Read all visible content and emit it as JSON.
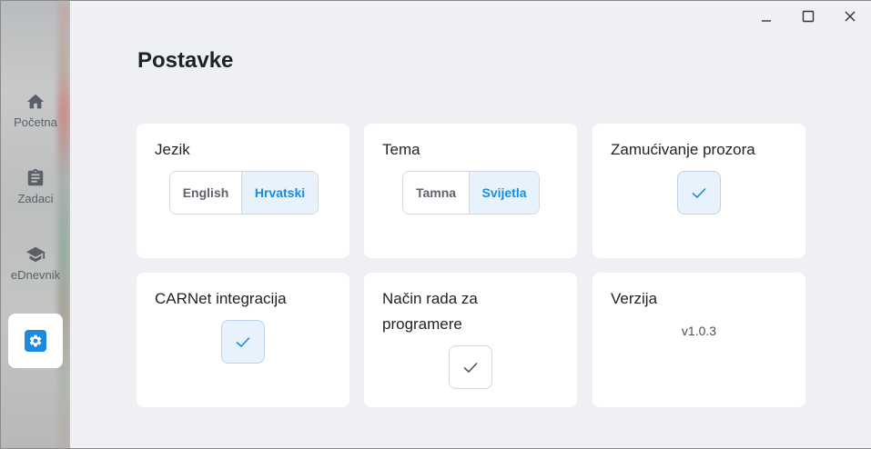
{
  "sidebar": {
    "items": [
      {
        "label": "Početna",
        "icon": "home-icon"
      },
      {
        "label": "Zadaci",
        "icon": "clipboard-icon"
      },
      {
        "label": "eDnevnik",
        "icon": "graduation-cap-icon"
      }
    ],
    "active": {
      "icon": "gear-icon"
    }
  },
  "window": {
    "minimize_icon": "minimize-icon",
    "maximize_icon": "maximize-icon",
    "close_icon": "close-icon"
  },
  "page": {
    "title": "Postavke"
  },
  "cards": {
    "language": {
      "title": "Jezik",
      "options": [
        "English",
        "Hrvatski"
      ],
      "selected": "Hrvatski"
    },
    "theme": {
      "title": "Tema",
      "options": [
        "Tamna",
        "Svijetla"
      ],
      "selected": "Svijetla"
    },
    "blur": {
      "title": "Zamućivanje prozora",
      "checked": true
    },
    "carnet": {
      "title": "CARNet integracija",
      "checked": true
    },
    "developer": {
      "title": "Način rada za programere",
      "checked": false
    },
    "version": {
      "title": "Verzija",
      "value": "v1.0.3"
    }
  },
  "colors": {
    "accent": "#1b8be0",
    "accent_bg": "#e8f2fc",
    "card_bg": "#ffffff",
    "page_bg": "#eef0f3"
  }
}
